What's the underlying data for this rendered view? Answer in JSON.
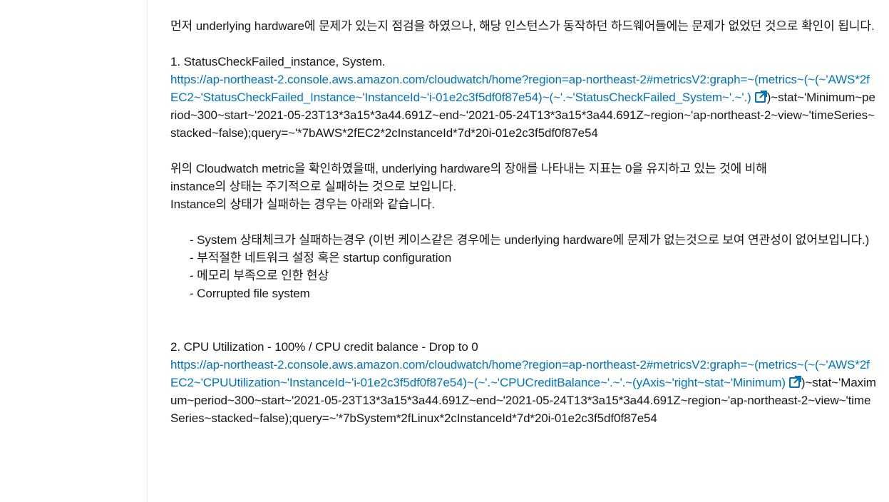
{
  "content": {
    "intro": "먼저 underlying hardware에 문제가 있는지 점검을 하였으나, 해당 인스턴스가 동작하던 하드웨어들에는 문제가 없었던 것으로 확인이 됩니다.",
    "item1_title": "1. StatusCheckFailed_instance, System.",
    "item1_link_text": "https://ap-northeast-2.console.aws.amazon.com/cloudwatch/home?region=ap-northeast-2#metricsV2:graph=~(metrics~(~(~'AWS*2fEC2~'StatusCheckFailed_Instance~'InstanceId~'i-01e2c3f5df0f87e54)~(~'.~'StatusCheckFailed_System~'.~'.)",
    "item1_link_tail": ")~stat~'Minimum~period~300~start~'2021-05-23T13*3a15*3a44.691Z~end~'2021-05-24T13*3a15*3a44.691Z~region~'ap-northeast-2~view~'timeSeries~stacked~false);query=~'*7bAWS*2fEC2*2cInstanceId*7d*20i-01e2c3f5df0f87e54",
    "para2_line1": "위의 Cloudwatch metric을 확인하였을때, underlying hardware의 장애를 나타내는 지표는 0을 유지하고 있는 것에 비해",
    "para2_line2": "instance의 상태는 주기적으로 실패하는 것으로 보입니다.",
    "para2_line3": "Instance의 상태가 실패하는 경우는 아래와 같습니다.",
    "bullet1": "- System 상태체크가 실패하는경우 (이번 케이스같은 경우에는 underlying hardware에 문제가 없는것으로 보여 연관성이 없어보입니다.)",
    "bullet2": "- 부적절한 네트워크 설정 혹은 startup configuration",
    "bullet3": "- 메모리 부족으로 인한 현상",
    "bullet4": "- Corrupted file system",
    "item2_title": "2. CPU Utilization - 100% /  CPU credit balance - Drop to 0",
    "item2_link_text": "https://ap-northeast-2.console.aws.amazon.com/cloudwatch/home?region=ap-northeast-2#metricsV2:graph=~(metrics~(~(~'AWS*2fEC2~'CPUUtilization~'InstanceId~'i-01e2c3f5df0f87e54)~(~'.~'CPUCreditBalance~'.~'.~(yAxis~'right~stat~'Minimum)",
    "item2_link_tail": ")~stat~'Maximum~period~300~start~'2021-05-23T13*3a15*3a44.691Z~end~'2021-05-24T13*3a15*3a44.691Z~region~'ap-northeast-2~view~'timeSeries~stacked~false);query=~'*7bSystem*2fLinux*2cInstanceId*7d*20i-01e2c3f5df0f87e54"
  },
  "colors": {
    "text": "#16191f",
    "link": "#0073bb",
    "divider": "#e9ebed"
  },
  "icons": {
    "external_link": "external-link-icon"
  }
}
